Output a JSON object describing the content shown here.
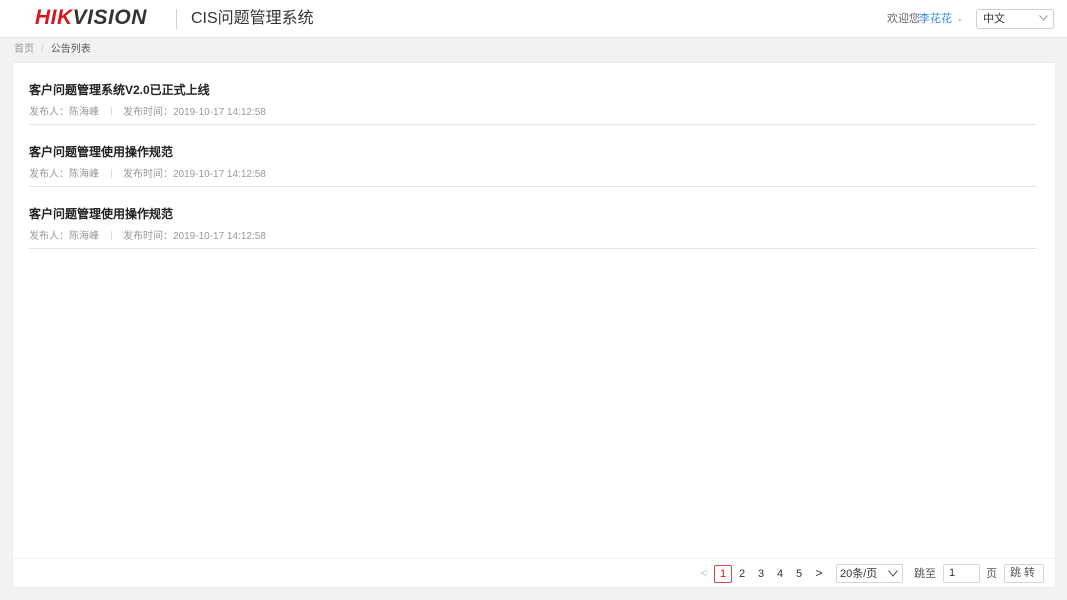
{
  "header": {
    "logo_red": "HIK",
    "logo_dark": "VISION",
    "app_title": "CIS问题管理系统",
    "welcome": "欢迎您",
    "user_name": "李花花",
    "language": "中文"
  },
  "breadcrumb": {
    "home": "首页",
    "separator": "/",
    "current": "公告列表"
  },
  "notices": [
    {
      "title": "客户问题管理系统V2.0已正式上线",
      "publisher": "发布人：陈海峰",
      "time": "发布时间：2019-10-17 14:12:58"
    },
    {
      "title": "客户问题管理使用操作规范",
      "publisher": "发布人：陈海峰",
      "time": "发布时间：2019-10-17 14:12:58"
    },
    {
      "title": "客户问题管理使用操作规范",
      "publisher": "发布人：陈海峰",
      "time": "发布时间：2019-10-17 14:12:58"
    }
  ],
  "pagination": {
    "prev": "<",
    "next": ">",
    "pages": [
      "1",
      "2",
      "3",
      "4",
      "5"
    ],
    "current_page": "1",
    "page_size": "20条/页",
    "jump_label": "跳至",
    "jump_value": "1",
    "page_label": "页",
    "jump_button": "跳转"
  },
  "colors": {
    "brand_red": "#d7171f",
    "link_blue": "#2f8ae5"
  }
}
